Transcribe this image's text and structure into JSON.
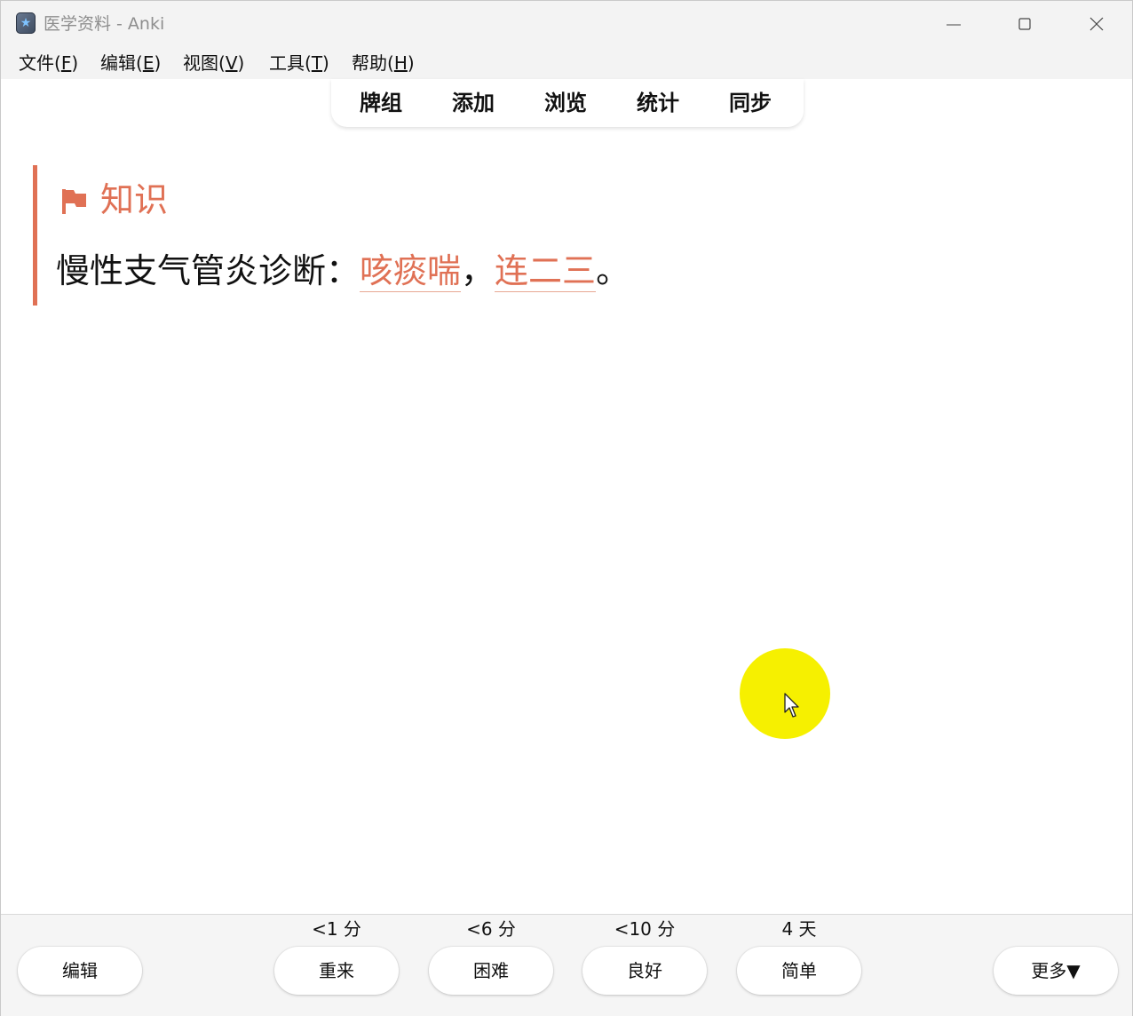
{
  "window": {
    "title": "医学资料 - Anki"
  },
  "menu": {
    "items": [
      {
        "label": "文件(",
        "accel": "F",
        "close": ")"
      },
      {
        "label": "编辑(",
        "accel": "E",
        "close": ")"
      },
      {
        "label": "视图(",
        "accel": "V",
        "close": ")"
      },
      {
        "label": "工具(",
        "accel": "T",
        "close": ")"
      },
      {
        "label": "帮助(",
        "accel": "H",
        "close": ")"
      }
    ]
  },
  "toolbar": {
    "items": [
      "牌组",
      "添加",
      "浏览",
      "统计",
      "同步"
    ]
  },
  "card": {
    "heading": "知识",
    "prefix": "慢性支气管炎诊断：",
    "cloze1": "咳痰喘",
    "sep": "，",
    "cloze2": "连二三",
    "suffix": "。",
    "accent_color": "#e07155"
  },
  "bottom": {
    "edit_label": "编辑",
    "answers": [
      {
        "interval": "<1 分",
        "label": "重来"
      },
      {
        "interval": "<6 分",
        "label": "困难"
      },
      {
        "interval": "<10 分",
        "label": "良好"
      },
      {
        "interval": "4 天",
        "label": "简单"
      }
    ],
    "more_label": "更多▼"
  }
}
